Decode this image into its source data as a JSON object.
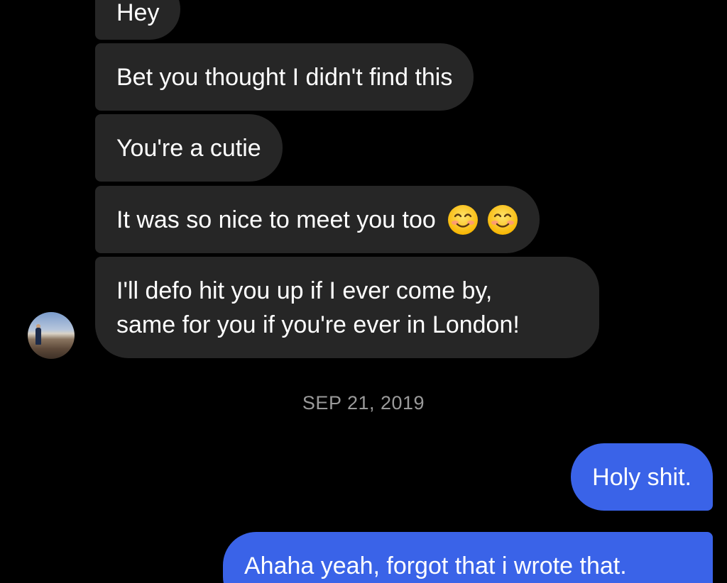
{
  "thread": {
    "incoming_messages": [
      {
        "text": "Hey"
      },
      {
        "text": "Bet you thought I didn't find this"
      },
      {
        "text": "You're a cutie"
      },
      {
        "text": "It was so nice to meet you too",
        "emojis": [
          "smiling-face-emoji",
          "smiling-face-emoji"
        ]
      },
      {
        "lines": [
          "I'll defo hit you up if I ever come by,",
          "same for you if you're ever in London!"
        ]
      }
    ],
    "date_separator": "SEP 21, 2019",
    "outgoing_messages": [
      {
        "text": "Holy shit."
      },
      {
        "text": "Ahaha yeah, forgot that i wrote that."
      }
    ]
  },
  "colors": {
    "background": "#000000",
    "incoming_bubble": "#262626",
    "outgoing_bubble": "#3a63e8",
    "date_text": "#9a9a9a",
    "text": "#ffffff"
  },
  "icons": {
    "avatar": "sender-avatar",
    "emoji": "smiling-face-emoji"
  }
}
